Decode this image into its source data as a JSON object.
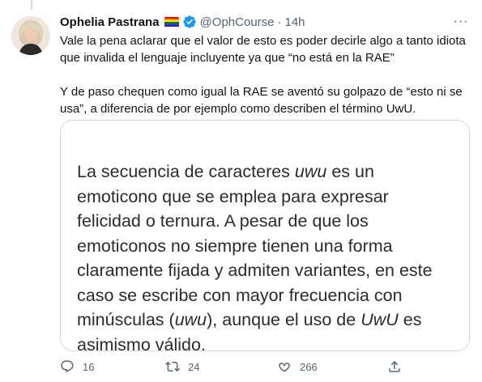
{
  "tweet": {
    "author_name": "Ophelia Pastrana",
    "handle": "@OphCourse",
    "separator": "·",
    "time": "14h",
    "more_label": "···",
    "text_paragraphs": [
      "Vale la pena aclarar que el valor de esto es poder decirle algo a tanto idiota que invalida el lenguaje incluyente ya que “no está en la RAE”",
      "Y de paso chequen como igual la RAE se aventó su golpazo de “esto ni se usa”, a diferencia de por ejemplo como describen el término UwU."
    ],
    "media": {
      "part1": "La secuencia de caracteres ",
      "em1": "uwu",
      "part2": " es un emoticono que se emplea para expresar felicidad o ternura. A pesar de que los emoticonos no siempre tienen una forma claramente fijada y admiten variantes, en este caso se escribe con mayor frecuencia con minúsculas (",
      "em2": "uwu",
      "part3": "), aunque el uso de ",
      "em3": "UwU",
      "part4": " es asimismo válido."
    },
    "actions": {
      "reply_count": "16",
      "retweet_count": "24",
      "like_count": "266"
    },
    "colors": {
      "secondary_text": "#536471",
      "verified": "#1d9bf0",
      "border": "#cfd9de"
    },
    "icons": [
      "verified-badge-icon",
      "pride-flag-icon",
      "more-icon",
      "reply-icon",
      "retweet-icon",
      "like-icon",
      "share-icon"
    ]
  }
}
